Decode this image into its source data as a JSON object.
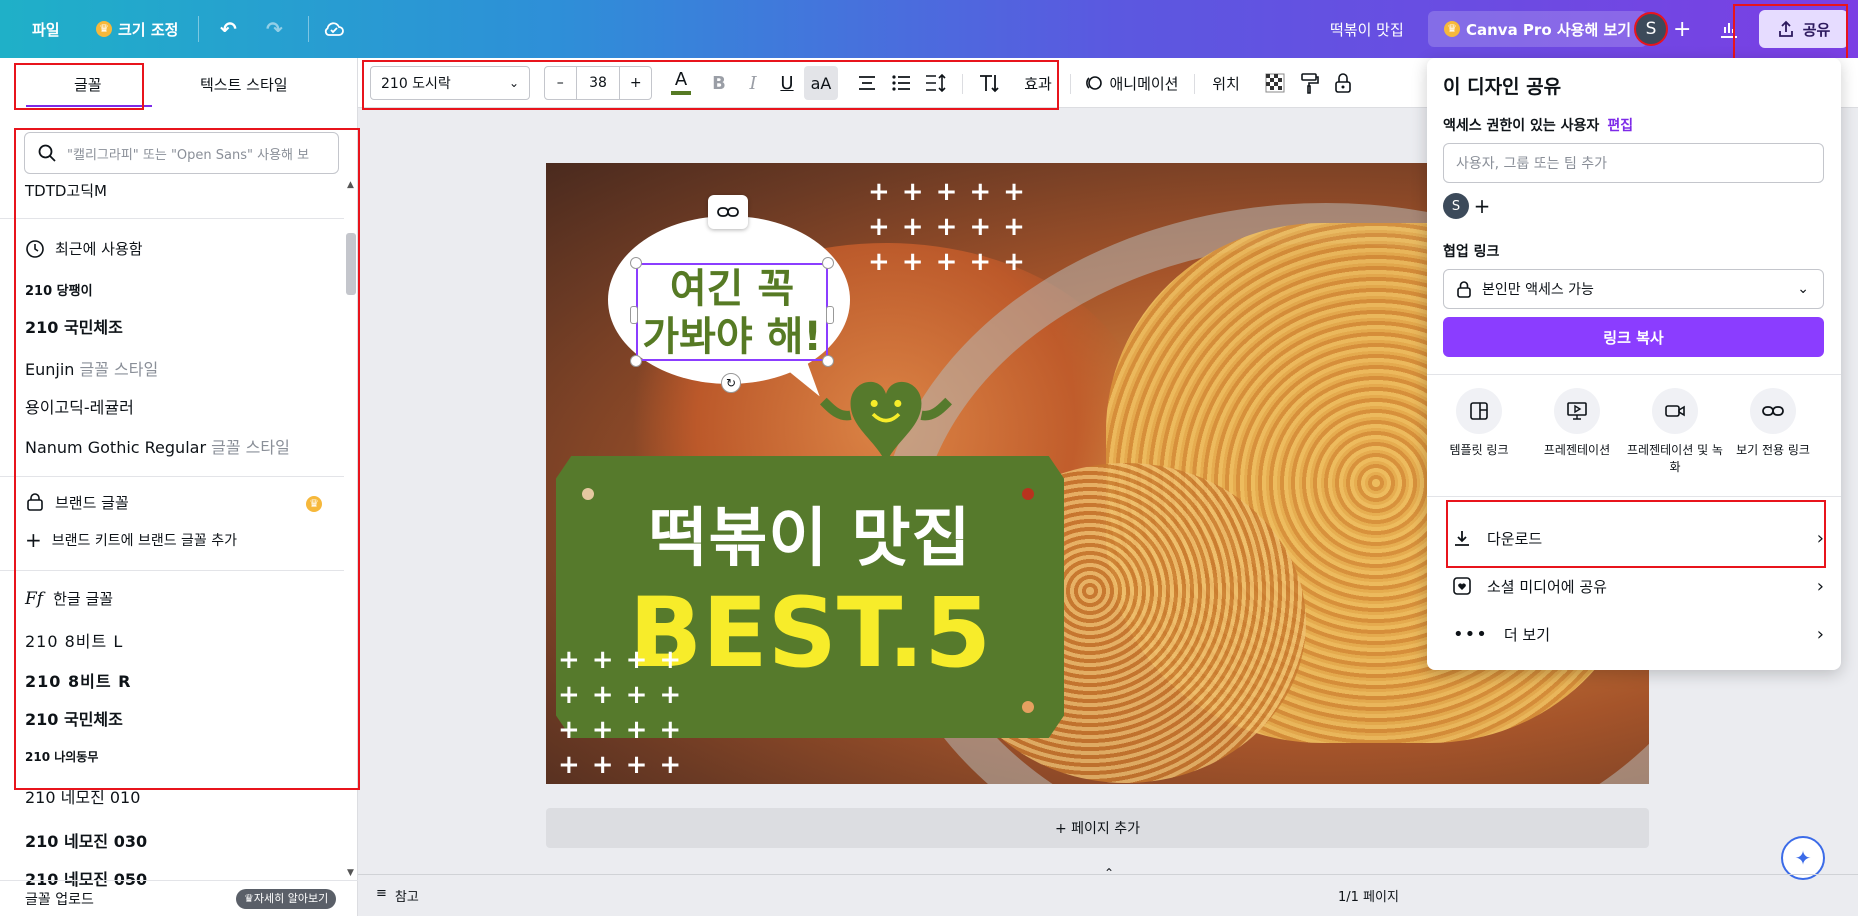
{
  "topbar": {
    "file": "파일",
    "resize": "크기 조정",
    "doc_title": "떡볶이 맛집",
    "pro": "Canva Pro 사용해 보기",
    "avatar": "S",
    "share": "공유"
  },
  "left_panel": {
    "tabs": [
      "글꼴",
      "텍스트 스타일"
    ],
    "search_placeholder": "\"캘리그라피\" 또는 \"Open Sans\" 사용해 보",
    "top_font": "TDTD고딕M",
    "recent_header": "최근에 사용함",
    "recent": [
      {
        "name": "210 당팽이",
        "hint": ""
      },
      {
        "name": "210 국민체조",
        "hint": ""
      },
      {
        "name": "Eunjin",
        "hint": "글꼴 스타일"
      },
      {
        "name": "용이고딕-레귤러",
        "hint": ""
      },
      {
        "name": "Nanum Gothic Regular",
        "hint": "글꼴 스타일"
      }
    ],
    "brand_header": "브랜드 글꼴",
    "brand_add": "브랜드 키트에 브랜드 글꼴 추가",
    "korean_header": "한글 글꼴",
    "korean": [
      "210 8비트 L",
      "210 8비트 R",
      "210 국민체조",
      "210 나의동무",
      "210 네모진 010",
      "210 네모진 030",
      "210 네모진 050"
    ],
    "upload": "글꼴 업로드",
    "learn_more": "자세히 알아보기"
  },
  "toolbar": {
    "font": "210 도시락",
    "minus": "–",
    "size": "38",
    "plus": "+",
    "color_letter": "A",
    "bold": "B",
    "italic": "I",
    "underline": "U",
    "case": "aA",
    "effects": "효과",
    "animate": "애니메이션",
    "position": "위치"
  },
  "canvas": {
    "bubble_line1": "여긴 꼭",
    "bubble_line2": "가봐야 해!",
    "title": "떡볶이 맛집",
    "best": "BEST.5",
    "add_page": "+ 페이지 추가"
  },
  "share_panel": {
    "title": "이 디자인 공유",
    "access_label": "액세스 권한이 있는 사용자",
    "edit": "편집",
    "input_placeholder": "사용자, 그룹 또는 팀 추가",
    "avatar": "S",
    "collab_label": "협업 링크",
    "access_option": "본인만 액세스 가능",
    "copy_link": "링크 복사",
    "options": [
      "템플릿 링크",
      "프레젠테이션",
      "프레젠테이션 및 녹화",
      "보기 전용 링크"
    ],
    "download": "다운로드",
    "social": "소셜 미디어에 공유",
    "more": "더 보기"
  },
  "footer": {
    "notes": "참고",
    "pages": "1/1 페이지"
  },
  "colors": {
    "accent": "#8b3dff",
    "card_green": "#567a2c",
    "best_yellow": "#f7ec2a",
    "highlight_red": "#e8141c"
  }
}
